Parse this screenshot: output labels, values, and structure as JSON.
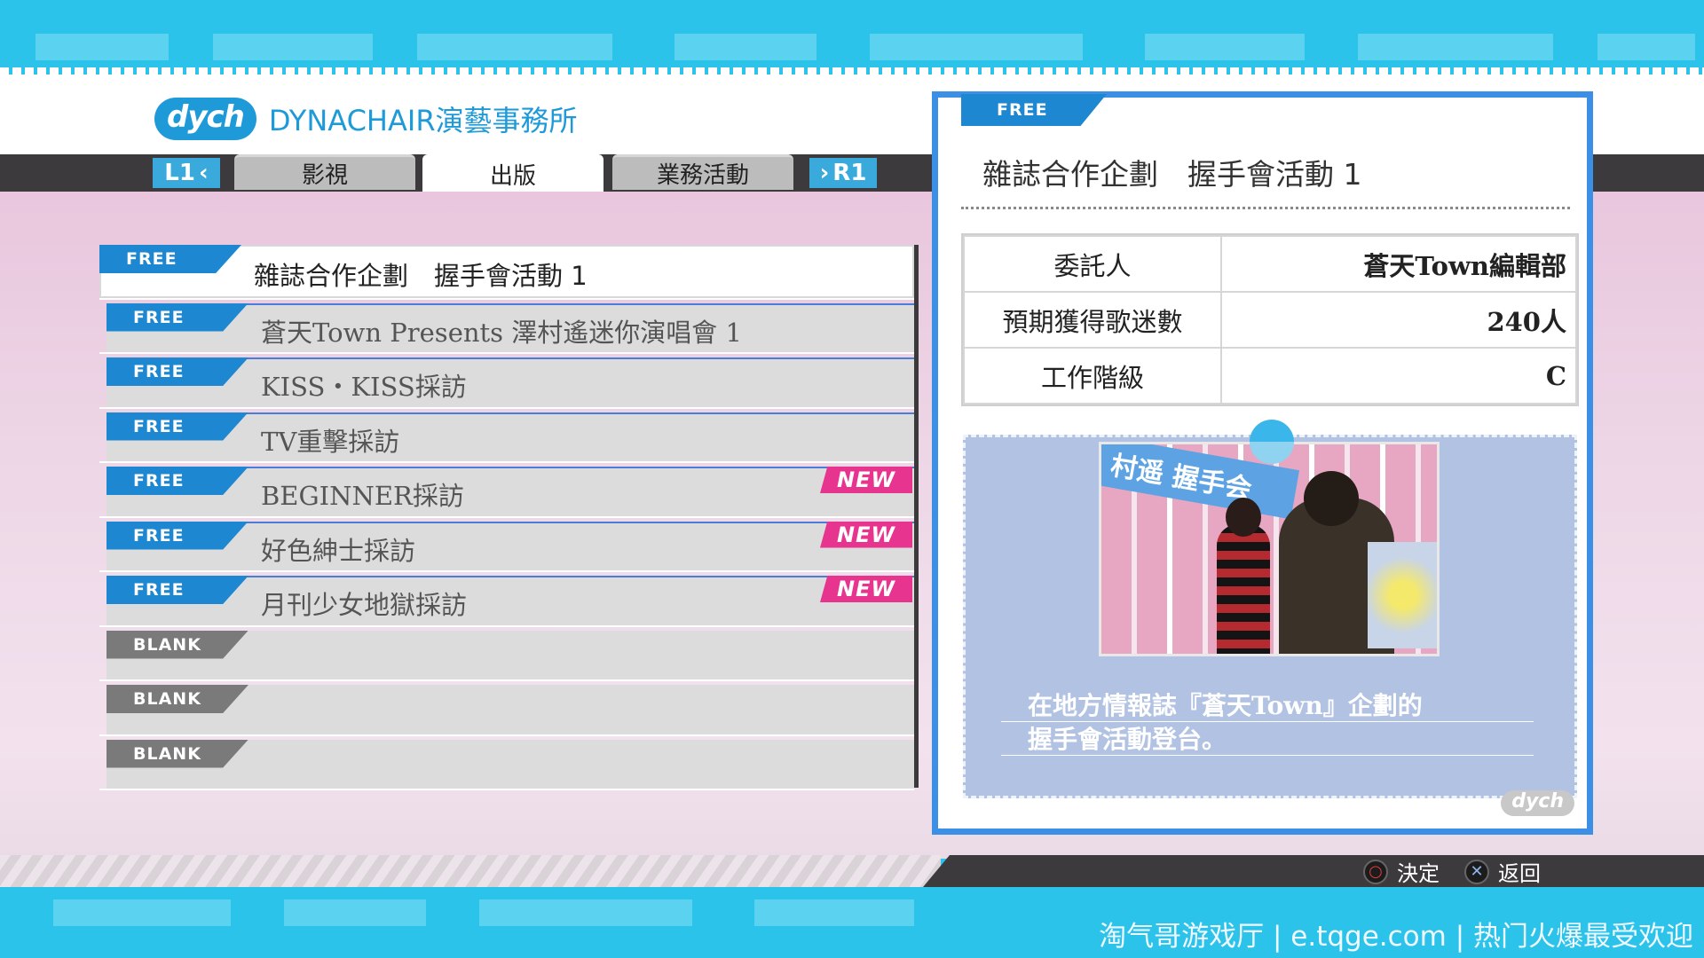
{
  "header": {
    "logo_text": "dych",
    "company_name": "DYNACHAIR演藝事務所"
  },
  "tabs": {
    "left_button": "L1",
    "right_button": "R1",
    "items": [
      {
        "label": "影視",
        "active": false
      },
      {
        "label": "出版",
        "active": true
      },
      {
        "label": "業務活動",
        "active": false
      }
    ]
  },
  "job_list": [
    {
      "badge": "FREE",
      "title": "雜誌合作企劃　握手會活動 1",
      "is_new": false,
      "selected": true
    },
    {
      "badge": "FREE",
      "title": "蒼天Town Presents 澤村遙迷你演唱會 1",
      "is_new": false,
      "selected": false
    },
    {
      "badge": "FREE",
      "title": "KISS・KISS採訪",
      "is_new": false,
      "selected": false
    },
    {
      "badge": "FREE",
      "title": "TV重擊採訪",
      "is_new": false,
      "selected": false
    },
    {
      "badge": "FREE",
      "title": "BEGINNER採訪",
      "is_new": true,
      "selected": false
    },
    {
      "badge": "FREE",
      "title": "好色紳士採訪",
      "is_new": true,
      "selected": false
    },
    {
      "badge": "FREE",
      "title": "月刊少女地獄採訪",
      "is_new": true,
      "selected": false
    },
    {
      "badge": "BLANK",
      "title": "",
      "is_new": false,
      "selected": false
    },
    {
      "badge": "BLANK",
      "title": "",
      "is_new": false,
      "selected": false
    },
    {
      "badge": "BLANK",
      "title": "",
      "is_new": false,
      "selected": false
    }
  ],
  "new_label": "NEW",
  "detail": {
    "badge": "FREE",
    "title": "雜誌合作企劃　握手會活動 1",
    "info": [
      {
        "key": "委託人",
        "value": "蒼天Town編輯部"
      },
      {
        "key": "預期獲得歌迷數",
        "value": "240人"
      },
      {
        "key": "工作階級",
        "value": "C"
      }
    ],
    "photo_sign_text": "村遥 握手会",
    "description_line1": "在地方情報誌『蒼天Town』企劃的",
    "description_line2": "握手會活動登台。",
    "corner_logo": "dych"
  },
  "controls": {
    "confirm_icon": "circle-button-icon",
    "confirm_label": "決定",
    "back_icon": "cross-button-icon",
    "back_label": "返回"
  },
  "watermark": "淘气哥游戏厅 | e.tqge.com | 热门火爆最受欢迎",
  "colors": {
    "accent_blue": "#1e87d2",
    "new_pink": "#e6348f",
    "panel_border": "#3b8fe4",
    "band_cyan": "#2bc3ea"
  }
}
